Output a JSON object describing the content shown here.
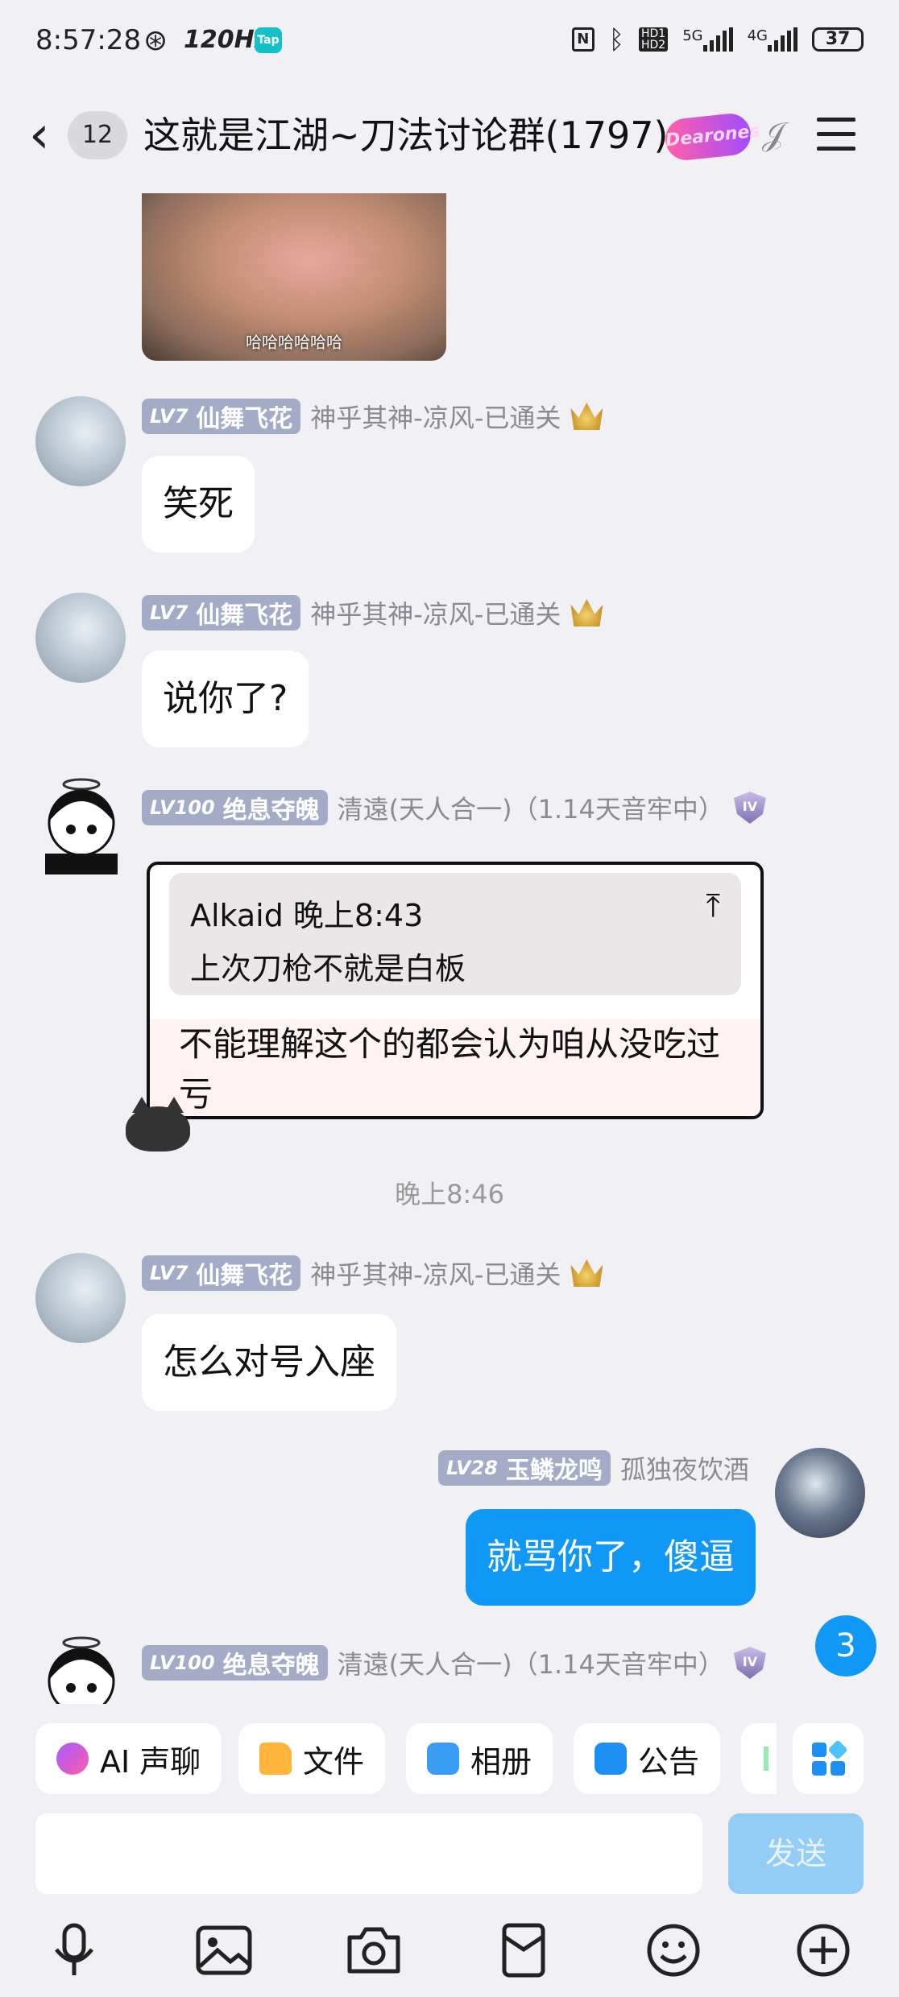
{
  "status_bar": {
    "time": "8:57:28",
    "refresh_rate": "120Hz",
    "tap_badge": "Tap",
    "network_5g": "5G",
    "network_4g": "4G",
    "hd1": "HD1",
    "hd2": "HD2",
    "battery": "37"
  },
  "header": {
    "unread_count": "12",
    "title": "这就是江湖~刀法讨论群(1797)",
    "badge_text": "Dearones"
  },
  "top_image": {
    "caption": "哈哈哈哈哈哈"
  },
  "messages": [
    {
      "level": "LV7",
      "nickname": "仙舞飞花",
      "title": "神乎其神-凉风-已通关",
      "text": "笑死"
    },
    {
      "level": "LV7",
      "nickname": "仙舞飞花",
      "title": "神乎其神-凉风-已通关",
      "text": "说你了?"
    },
    {
      "level": "LV100",
      "nickname": "绝息夺魄",
      "title": "清遠(天人合一)（1.14天音牢中）",
      "level_icon": "IV",
      "quote_author": "Alkaid 晚上8:43",
      "quote_text": "上次刀枪不就是白板",
      "text": "不能理解这个的都会认为咱从没吃过亏"
    },
    {
      "level": "LV7",
      "nickname": "仙舞飞花",
      "title": "神乎其神-凉风-已通关",
      "text": "怎么对号入座"
    },
    {
      "level": "LV28",
      "nickname": "玉鳞龙鸣",
      "title": "孤独夜饮酒",
      "text": "就骂你了，傻逼"
    },
    {
      "level": "LV100",
      "nickname": "绝息夺魄",
      "title": "清遠(天人合一)（1.14天音牢中）",
      "level_icon": "IV"
    }
  ],
  "timestamp": "晚上8:46",
  "unread_float": "3",
  "quick_actions": [
    {
      "label": "AI 声聊",
      "icon": "ai-voice-icon"
    },
    {
      "label": "文件",
      "icon": "folder-icon"
    },
    {
      "label": "相册",
      "icon": "album-icon"
    },
    {
      "label": "公告",
      "icon": "announcement-icon"
    }
  ],
  "input": {
    "placeholder": "",
    "send_label": "发送"
  },
  "toolbar": [
    "microphone-icon",
    "image-icon",
    "camera-icon",
    "red-packet-icon",
    "emoji-icon",
    "plus-icon"
  ],
  "colors": {
    "background": "#f0f0f5",
    "accent": "#0f98f5",
    "level_badge": "#a4abc6",
    "send_disabled": "#93ccf4"
  }
}
